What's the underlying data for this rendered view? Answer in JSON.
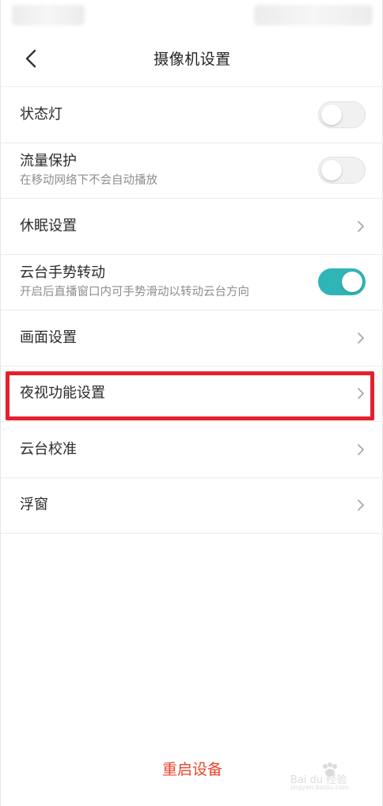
{
  "header": {
    "title": "摄像机设置",
    "back_icon": "chevron-left-icon"
  },
  "settings": [
    {
      "label": "状态灯",
      "control": "toggle",
      "on": false
    },
    {
      "label": "流量保护",
      "sublabel": "在移动网络下不会自动播放",
      "control": "toggle",
      "on": false
    },
    {
      "label": "休眠设置",
      "control": "chevron"
    },
    {
      "label": "云台手势转动",
      "sublabel": "开启后直播窗口内可手势滑动以转动云台方向",
      "control": "toggle",
      "on": true
    },
    {
      "label": "画面设置",
      "control": "chevron"
    },
    {
      "label": "夜视功能设置",
      "control": "chevron",
      "highlighted": true
    },
    {
      "label": "云台校准",
      "control": "chevron"
    },
    {
      "label": "浮窗",
      "control": "chevron"
    }
  ],
  "footer": {
    "restart_label": "重启设备"
  },
  "watermark": {
    "main": "Bai du 经验",
    "sub": "jingyan.baidu.com"
  },
  "colors": {
    "accent_toggle": "#2fb5b5",
    "restart_text": "#e8442c",
    "highlight_border": "#e5202d"
  }
}
